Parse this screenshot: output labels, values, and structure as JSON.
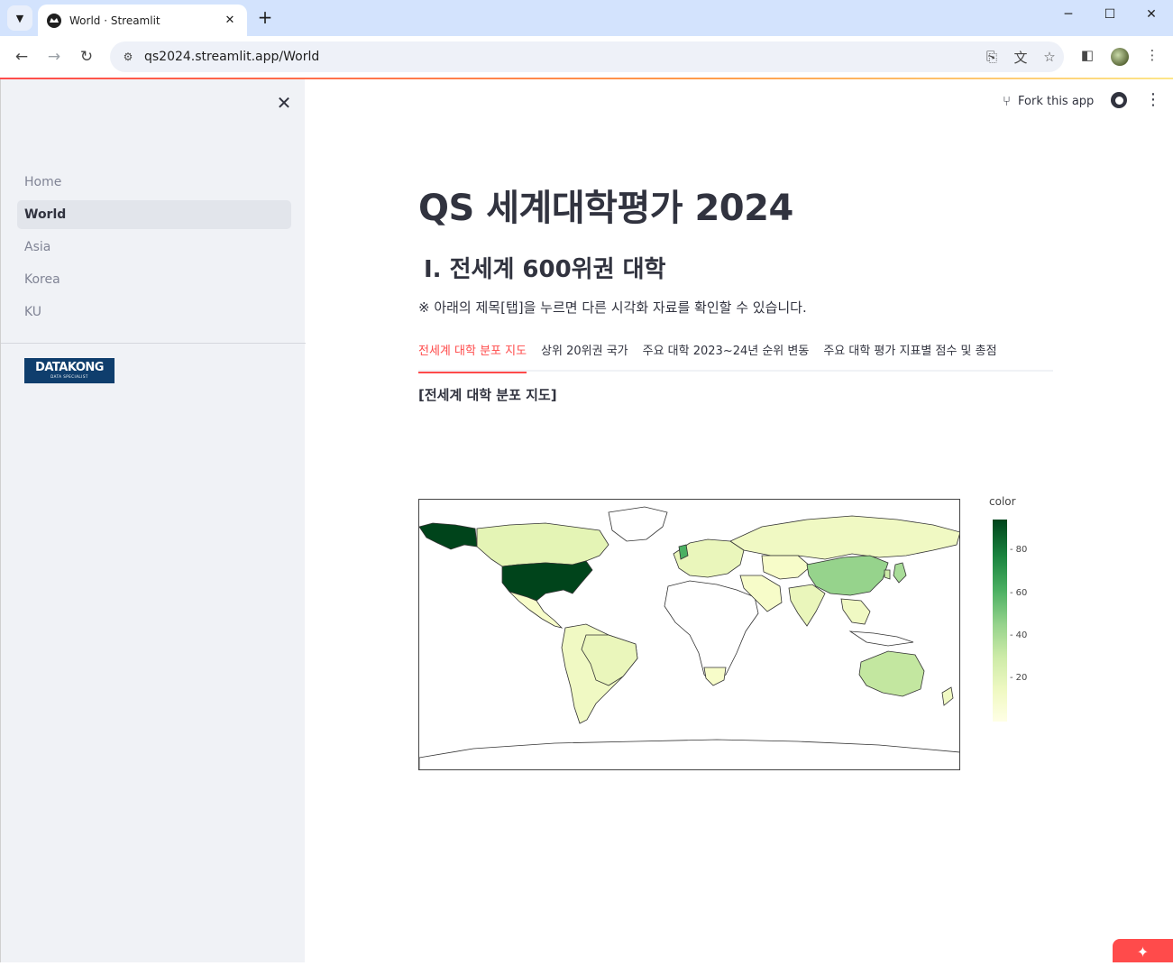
{
  "browser": {
    "tab_title": "World · Streamlit",
    "url": "qs2024.streamlit.app/World",
    "new_tab_glyph": "+",
    "tab_close_glyph": "✕"
  },
  "sidebar": {
    "items": [
      {
        "label": "Home",
        "active": false
      },
      {
        "label": "World",
        "active": true
      },
      {
        "label": "Asia",
        "active": false
      },
      {
        "label": "Korea",
        "active": false
      },
      {
        "label": "KU",
        "active": false
      }
    ],
    "logo_text": "DATAKONG",
    "logo_sub": "DATA SPECIALIST"
  },
  "header": {
    "fork_label": "Fork this app"
  },
  "main": {
    "title": "QS 세계대학평가 2024",
    "subtitle": "Ⅰ. 전세계 600위권 대학",
    "note": "※ 아래의 제목[탭]을 누르면 다른 시각화 자료를 확인할 수 있습니다.",
    "tabs": [
      {
        "label": "전세계 대학 분포 지도",
        "active": true
      },
      {
        "label": "상위 20위권 국가",
        "active": false
      },
      {
        "label": "주요 대학 2023~24년 순위 변동",
        "active": false
      },
      {
        "label": "주요 대학 평가 지표별 점수 및 총점",
        "active": false
      }
    ],
    "section_label": "[전세계 대학 분포 지도]"
  },
  "chart_data": {
    "type": "choropleth",
    "colorbar_title": "color",
    "colorscale": [
      "#ffffe5",
      "#00441b"
    ],
    "colorbar_ticks": [
      80,
      60,
      40,
      20
    ],
    "zmax": 95,
    "zmin": 0
  },
  "colors": {
    "accent": "#ff4b4b",
    "sidebar_bg": "#f0f2f6",
    "text": "#31333f"
  }
}
